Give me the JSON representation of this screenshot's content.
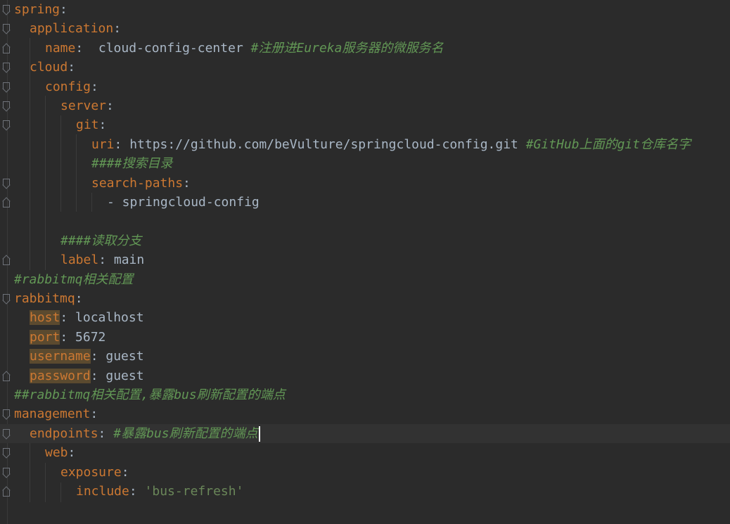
{
  "editor": {
    "language": "yaml",
    "colors": {
      "background": "#2b2b2b",
      "current_line": "#323232",
      "key": "#cc7832",
      "value": "#a9b7c6",
      "string": "#6a8759",
      "comment": "#629755",
      "highlight": "#5b4a2f"
    },
    "lines": [
      {
        "k": "spring",
        "sep": ":",
        "v": "",
        "c": ""
      },
      {
        "k": "application",
        "sep": ":",
        "v": "",
        "c": ""
      },
      {
        "k": "name",
        "sep": ":",
        "v": "  cloud-config-center ",
        "c": "#注册进Eureka服务器的微服务名"
      },
      {
        "k": "cloud",
        "sep": ":",
        "v": "",
        "c": ""
      },
      {
        "k": "config",
        "sep": ":",
        "v": "",
        "c": ""
      },
      {
        "k": "server",
        "sep": ":",
        "v": "",
        "c": ""
      },
      {
        "k": "git",
        "sep": ":",
        "v": "",
        "c": ""
      },
      {
        "k": "uri",
        "sep": ":",
        "v": " https://github.com/beVulture/springcloud-config.git ",
        "c": "#GitHub上面的git仓库名字"
      },
      {
        "k": "",
        "sep": "",
        "v": "",
        "c": "####搜索目录"
      },
      {
        "k": "search-paths",
        "sep": ":",
        "v": "",
        "c": ""
      },
      {
        "k": "",
        "sep": "",
        "v": "- springcloud-config",
        "c": ""
      },
      {
        "k": "",
        "sep": "",
        "v": "",
        "c": ""
      },
      {
        "k": "",
        "sep": "",
        "v": "",
        "c": "####读取分支"
      },
      {
        "k": "label",
        "sep": ":",
        "v": " main",
        "c": ""
      },
      {
        "k": "",
        "sep": "",
        "v": "",
        "c": "#rabbitmq相关配置"
      },
      {
        "k": "rabbitmq",
        "sep": ":",
        "v": "",
        "c": ""
      },
      {
        "k": "host",
        "sep": ":",
        "v": " localhost",
        "c": ""
      },
      {
        "k": "port",
        "sep": ":",
        "v": " 5672",
        "c": ""
      },
      {
        "k": "username",
        "sep": ":",
        "v": " guest",
        "c": ""
      },
      {
        "k": "password",
        "sep": ":",
        "v": " guest",
        "c": ""
      },
      {
        "k": "",
        "sep": "",
        "v": "",
        "c": "##rabbitmq相关配置,暴露bus刷新配置的端点"
      },
      {
        "k": "management",
        "sep": ":",
        "v": "",
        "c": ""
      },
      {
        "k": "endpoints",
        "sep": ":",
        "v": " ",
        "c": "#暴露bus刷新配置的端点"
      },
      {
        "k": "web",
        "sep": ":",
        "v": "",
        "c": ""
      },
      {
        "k": "exposure",
        "sep": ":",
        "v": "",
        "c": ""
      },
      {
        "k": "include",
        "sep": ":",
        "v": " ",
        "s": "'bus-refresh'",
        "c": ""
      }
    ]
  }
}
